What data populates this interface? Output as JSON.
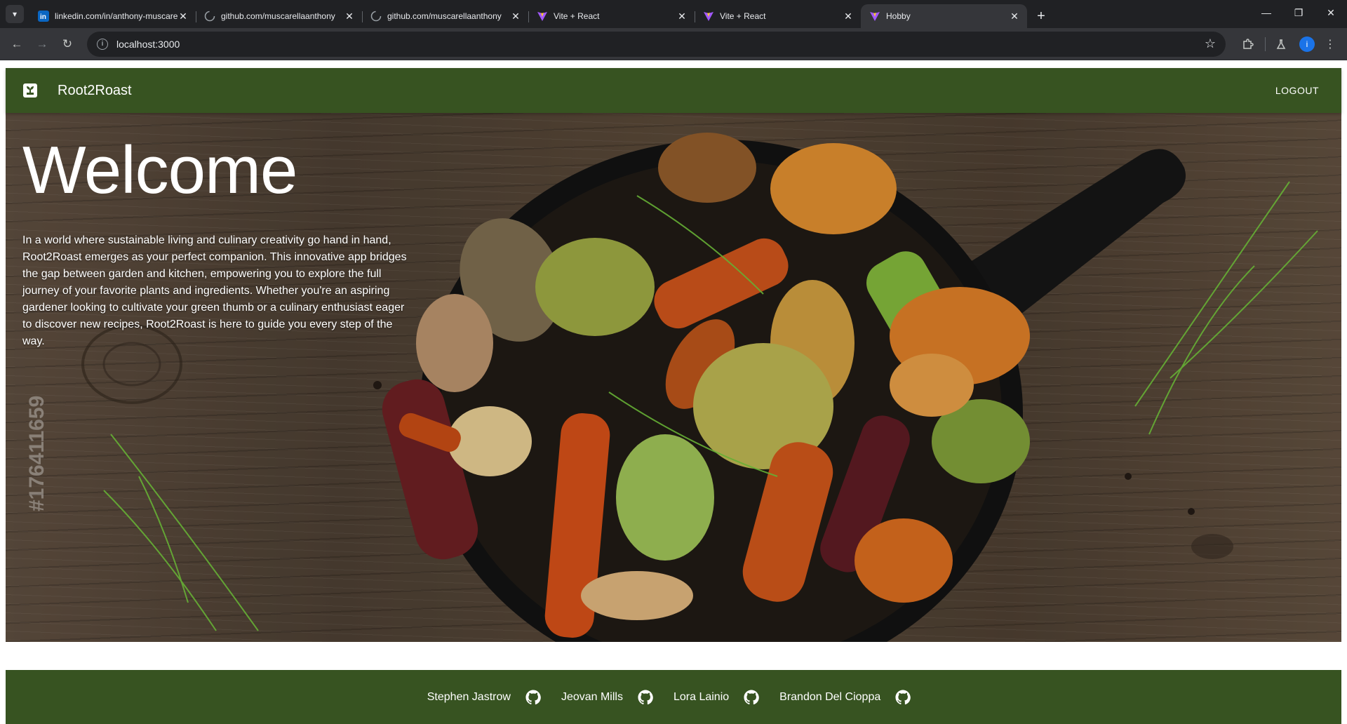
{
  "browser": {
    "tabs": [
      {
        "title": "linkedin.com/in/anthony-muscarella",
        "icon": "linkedin-icon",
        "active": false
      },
      {
        "title": "github.com/muscarellaanthony",
        "icon": "loading-icon",
        "active": false
      },
      {
        "title": "github.com/muscarellaanthony",
        "icon": "loading-icon",
        "active": false
      },
      {
        "title": "Vite + React",
        "icon": "vite-icon",
        "active": false
      },
      {
        "title": "Vite + React",
        "icon": "vite-icon",
        "active": false
      },
      {
        "title": "Hobby",
        "icon": "vite-icon",
        "active": true
      }
    ],
    "address": "localhost:3000",
    "profile_initial": "i"
  },
  "app": {
    "brand": "Root2Roast",
    "logout_label": "LOGOUT",
    "accent_color": "#375321"
  },
  "hero": {
    "title": "Welcome",
    "description": "In a world where sustainable living and culinary creativity go hand in hand, Root2Roast emerges as your perfect companion. This innovative app bridges the gap between garden and kitchen, empowering you to explore the full journey of your favorite plants and ingredients. Whether you're an aspiring gardener looking to cultivate your green thumb or a culinary enthusiast eager to discover new recipes, Root2Roast is here to guide you every step of the way.",
    "watermark": "#176411659"
  },
  "footer": {
    "credits": [
      {
        "name": "Stephen Jastrow",
        "icon": "github-icon"
      },
      {
        "name": "Jeovan Mills",
        "icon": "github-icon"
      },
      {
        "name": "Lora Lainio",
        "icon": "github-icon"
      },
      {
        "name": "Brandon Del Cioppa",
        "icon": "github-icon"
      }
    ]
  }
}
